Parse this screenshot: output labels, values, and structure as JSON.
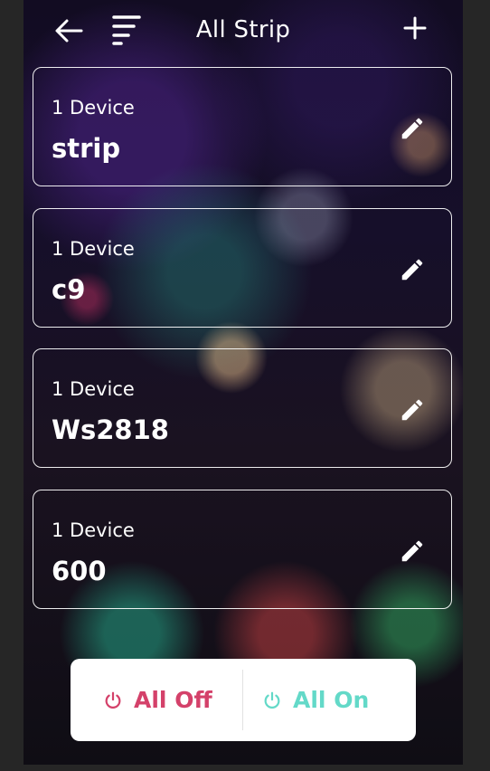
{
  "header": {
    "title": "All Strip",
    "back_icon": "arrow-left-icon",
    "menu_icon": "sort-menu-icon",
    "add_icon": "plus-icon"
  },
  "groups": [
    {
      "count": "1 Device",
      "name": "strip"
    },
    {
      "count": "1 Device",
      "name": "c9"
    },
    {
      "count": "1 Device",
      "name": "Ws2818"
    },
    {
      "count": "1 Device",
      "name": "600"
    }
  ],
  "footer": {
    "off_label": "All Off",
    "on_label": "All On",
    "off_color": "#d4416a",
    "on_color": "#63d9c8"
  }
}
